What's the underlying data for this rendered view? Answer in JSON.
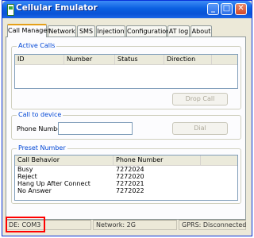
{
  "window": {
    "title": "Cellular Emulator"
  },
  "titlebar": {
    "minimize": "_",
    "maximize": "□",
    "close": "✕"
  },
  "tabs": [
    "Call Manager",
    "Network",
    "SMS",
    "Injection",
    "Configuration",
    "AT log",
    "About"
  ],
  "active_calls": {
    "title": "Active Calls",
    "columns": [
      "ID",
      "Number",
      "Status",
      "Direction"
    ],
    "drop_call": "Drop Call"
  },
  "call_to_device": {
    "title": "Call to device",
    "phone_label": "Phone Number:",
    "phone_value": "",
    "dial": "Dial"
  },
  "preset": {
    "title": "Preset Number",
    "columns": [
      "Call Behavior",
      "Phone Number"
    ],
    "rows": [
      {
        "behavior": "Busy",
        "number": "7272024"
      },
      {
        "behavior": "Reject",
        "number": "7272020"
      },
      {
        "behavior": "Hang Up After Connect",
        "number": "7272021"
      },
      {
        "behavior": "No Answer",
        "number": "7272022"
      }
    ]
  },
  "statusbar": {
    "port": "DE: COM3",
    "network": "Network: 2G",
    "gprs": "GPRS: Disconnected"
  },
  "colors": {
    "highlight": "#ff0000",
    "title_blue": "#0a5fe0",
    "group_title": "#0046d5"
  }
}
